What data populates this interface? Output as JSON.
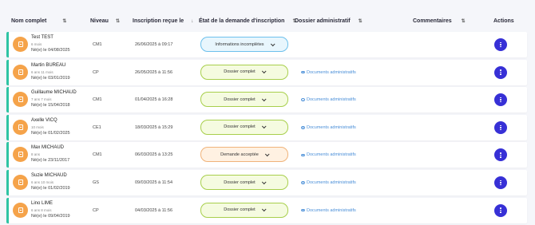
{
  "columns": {
    "name": "Nom complet",
    "level": "Niveau",
    "date": "Inscription reçue le",
    "status": "État de la demande d'inscription",
    "admin": "Dossier administratif",
    "comments": "Commentaires",
    "actions": "Actions"
  },
  "sort_glyph": "⇅",
  "date_sort_glyph": "↓",
  "docs_label": "Documents administratifs",
  "status_colors": {
    "blue": "#e8f6fd",
    "green": "#f5fbe0",
    "orange": "#fff1e2",
    "accent": "#2ec4a4",
    "action": "#3730d6"
  },
  "rows": [
    {
      "name": "Test TEST",
      "age": "6 mois",
      "birth": "Né(e) le 04/08/2025",
      "level": "CM1",
      "date": "26/06/2025 à 09:17",
      "status": "Informations incomplètes",
      "status_kind": "blue",
      "docs": false
    },
    {
      "name": "Martin BUREAU",
      "age": "6 ans 11 mois",
      "birth": "Né(e) le 03/01/2019",
      "level": "CP",
      "date": "26/05/2025 à 11:56",
      "status": "Dossier complet",
      "status_kind": "green",
      "docs": true
    },
    {
      "name": "Guillaume MICHAUD",
      "age": "7 ans 7 mois",
      "birth": "Né(e) le 15/04/2018",
      "level": "CM1",
      "date": "01/04/2025 à 16:28",
      "status": "Dossier complet",
      "status_kind": "green",
      "docs": true
    },
    {
      "name": "Axelle VICQ",
      "age": "10 mois",
      "birth": "Né(e) le 01/02/2025",
      "level": "CE1",
      "date": "18/03/2025 à 15:29",
      "status": "Dossier complet",
      "status_kind": "green",
      "docs": true
    },
    {
      "name": "Max MICHAUD",
      "age": "8 ans",
      "birth": "Né(e) le 23/11/2017",
      "level": "CM1",
      "date": "06/03/2025 à 13:25",
      "status": "Demande acceptée",
      "status_kind": "orange",
      "docs": true
    },
    {
      "name": "Suzie MICHAUD",
      "age": "6 ans 10 mois",
      "birth": "Né(e) le 01/02/2019",
      "level": "GS",
      "date": "09/03/2025 à 11:54",
      "status": "Dossier complet",
      "status_kind": "green",
      "docs": true
    },
    {
      "name": "Lino LIME",
      "age": "6 ans 8 mois",
      "birth": "Né(e) le 09/04/2019",
      "level": "CP",
      "date": "04/03/2025 à 11:56",
      "status": "Dossier complet",
      "status_kind": "green",
      "docs": true
    }
  ]
}
